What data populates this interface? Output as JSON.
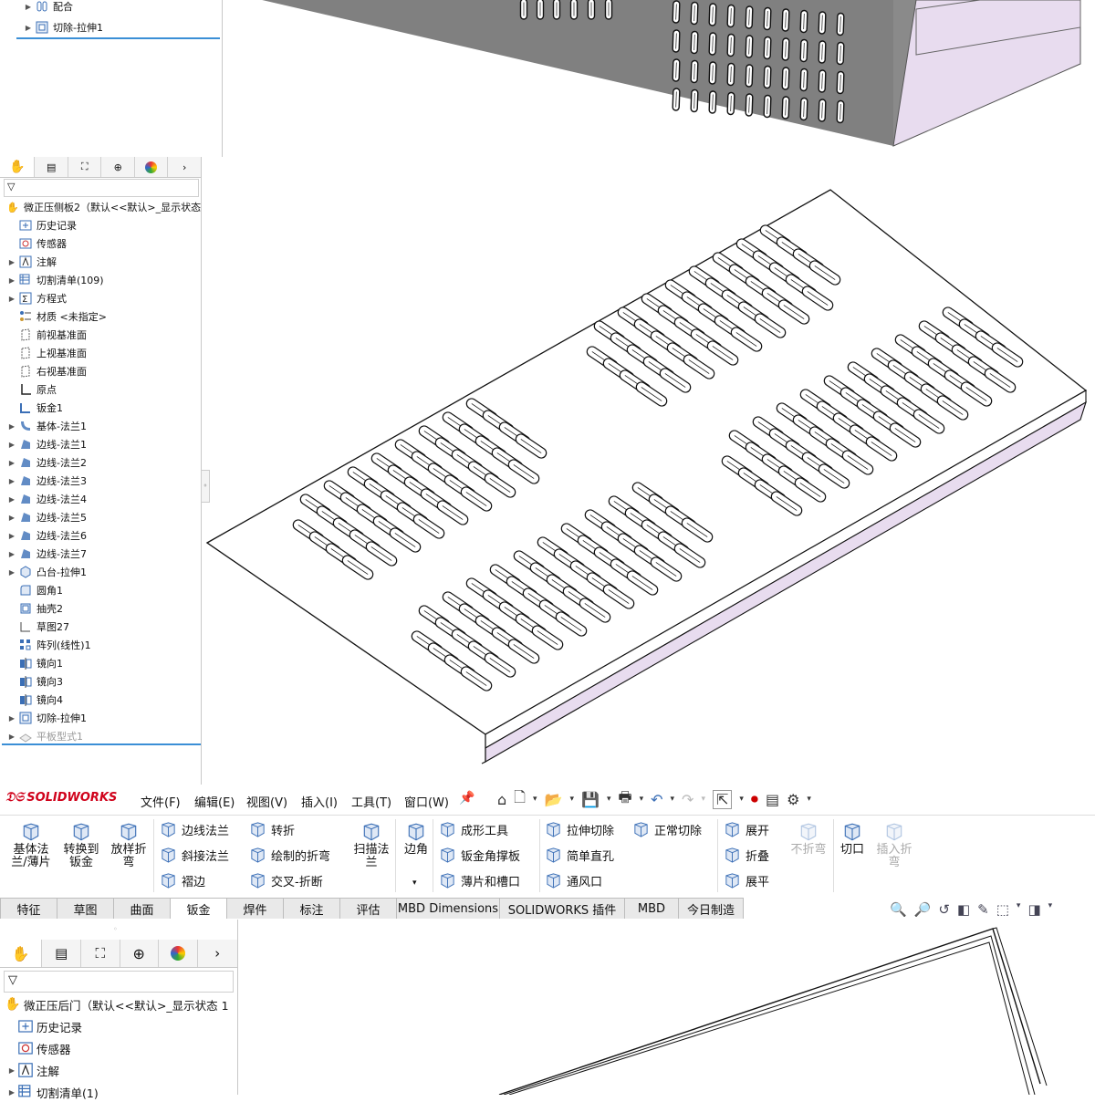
{
  "panel1": {
    "rows": [
      {
        "label": "配合",
        "icon": "mate-icon"
      },
      {
        "label": "切除-拉伸1",
        "icon": "cut-extrude-icon"
      }
    ]
  },
  "panel2": {
    "root": "微正压侧板2（默认<<默认>_显示状态",
    "rows": [
      {
        "label": "历史记录",
        "arrow": false,
        "icon": "history-icon"
      },
      {
        "label": "传感器",
        "arrow": false,
        "icon": "sensor-icon"
      },
      {
        "label": "注解",
        "arrow": true,
        "icon": "annotation-icon"
      },
      {
        "label": "切割清单(109)",
        "arrow": true,
        "icon": "cut-list-icon"
      },
      {
        "label": "方程式",
        "arrow": true,
        "icon": "equation-icon"
      },
      {
        "label": "材质 <未指定>",
        "arrow": false,
        "icon": "material-icon"
      },
      {
        "label": "前视基准面",
        "arrow": false,
        "icon": "plane-icon"
      },
      {
        "label": "上视基准面",
        "arrow": false,
        "icon": "plane-icon"
      },
      {
        "label": "右视基准面",
        "arrow": false,
        "icon": "plane-icon"
      },
      {
        "label": "原点",
        "arrow": false,
        "icon": "origin-icon"
      },
      {
        "label": "钣金1",
        "arrow": false,
        "icon": "sheet-metal-icon"
      },
      {
        "label": "基体-法兰1",
        "arrow": true,
        "icon": "base-flange-icon"
      },
      {
        "label": "边线-法兰1",
        "arrow": true,
        "icon": "edge-flange-icon"
      },
      {
        "label": "边线-法兰2",
        "arrow": true,
        "icon": "edge-flange-icon"
      },
      {
        "label": "边线-法兰3",
        "arrow": true,
        "icon": "edge-flange-icon"
      },
      {
        "label": "边线-法兰4",
        "arrow": true,
        "icon": "edge-flange-icon"
      },
      {
        "label": "边线-法兰5",
        "arrow": true,
        "icon": "edge-flange-icon"
      },
      {
        "label": "边线-法兰6",
        "arrow": true,
        "icon": "edge-flange-icon"
      },
      {
        "label": "边线-法兰7",
        "arrow": true,
        "icon": "edge-flange-icon"
      },
      {
        "label": "凸台-拉伸1",
        "arrow": true,
        "icon": "boss-extrude-icon"
      },
      {
        "label": "圆角1",
        "arrow": false,
        "icon": "fillet-icon"
      },
      {
        "label": "抽壳2",
        "arrow": false,
        "icon": "shell-icon"
      },
      {
        "label": "草图27",
        "arrow": false,
        "icon": "sketch-icon"
      },
      {
        "label": "阵列(线性)1",
        "arrow": false,
        "icon": "linear-pattern-icon"
      },
      {
        "label": "镜向1",
        "arrow": false,
        "icon": "mirror-icon"
      },
      {
        "label": "镜向3",
        "arrow": false,
        "icon": "mirror-icon"
      },
      {
        "label": "镜向4",
        "arrow": false,
        "icon": "mirror-icon"
      },
      {
        "label": "切除-拉伸1",
        "arrow": true,
        "icon": "cut-extrude-icon"
      },
      {
        "label": "平板型式1",
        "arrow": true,
        "icon": "flat-pattern-icon",
        "gray": true
      }
    ]
  },
  "app": {
    "brand": "SOLIDWORKS",
    "menus": [
      "文件(F)",
      "编辑(E)",
      "视图(V)",
      "插入(I)",
      "工具(T)",
      "窗口(W)"
    ]
  },
  "ribbon": {
    "big1": [
      {
        "label": "基体法\n兰/薄片",
        "icon": "base-flange-icon"
      },
      {
        "label": "转换到\n钣金",
        "icon": "convert-sheet-metal-icon"
      },
      {
        "label": "放样折\n弯",
        "icon": "lofted-bend-icon"
      }
    ],
    "col1": [
      {
        "label": "边线法兰",
        "icon": "edge-flange-icon"
      },
      {
        "label": "斜接法兰",
        "icon": "miter-flange-icon"
      },
      {
        "label": "褶边",
        "icon": "hem-icon"
      }
    ],
    "col2": [
      {
        "label": "转折",
        "icon": "jog-icon"
      },
      {
        "label": "绘制的折弯",
        "icon": "sketched-bend-icon"
      },
      {
        "label": "交叉-折断",
        "icon": "cross-break-icon"
      }
    ],
    "sweep": {
      "label": "扫描法\n兰",
      "icon": "swept-flange-icon"
    },
    "corner": {
      "label": "边角",
      "icon": "corner-icon"
    },
    "col3": [
      {
        "label": "成形工具",
        "icon": "forming-tool-icon"
      },
      {
        "label": "钣金角撑板",
        "icon": "gusset-icon"
      },
      {
        "label": "薄片和槽口",
        "icon": "tab-slot-icon"
      }
    ],
    "col4": [
      {
        "label": "拉伸切除",
        "icon": "extruded-cut-icon"
      },
      {
        "label": "简单直孔",
        "icon": "simple-hole-icon"
      },
      {
        "label": "通风口",
        "icon": "vent-icon"
      }
    ],
    "col5": [
      {
        "label": "正常切除",
        "icon": "normal-cut-icon"
      }
    ],
    "col6": [
      {
        "label": "展开",
        "icon": "unfold-icon"
      },
      {
        "label": "折叠",
        "icon": "fold-icon"
      },
      {
        "label": "展平",
        "icon": "flatten-icon"
      }
    ],
    "nofold": {
      "label": "不折弯",
      "icon": "no-bends-icon"
    },
    "rip": {
      "label": "切口",
      "icon": "rip-icon"
    },
    "insertbends": {
      "label": "插入折\n弯",
      "icon": "insert-bends-icon"
    }
  },
  "tabs": [
    "特征",
    "草图",
    "曲面",
    "钣金",
    "焊件",
    "标注",
    "评估",
    "MBD Dimensions",
    "SOLIDWORKS 插件",
    "MBD",
    "今日制造"
  ],
  "active_tab": "钣金",
  "panel3": {
    "root": "微正压后门（默认<<默认>_显示状态 1",
    "rows": [
      {
        "label": "历史记录",
        "arrow": false,
        "icon": "history-icon"
      },
      {
        "label": "传感器",
        "arrow": false,
        "icon": "sensor-icon"
      },
      {
        "label": "注解",
        "arrow": true,
        "icon": "annotation-icon"
      },
      {
        "label": "切割清单(1)",
        "arrow": true,
        "icon": "cut-list-icon"
      }
    ]
  },
  "colors": {
    "brand_red": "#d0021b",
    "flange_face": "#e8dcef",
    "part_gray": "#808080"
  }
}
